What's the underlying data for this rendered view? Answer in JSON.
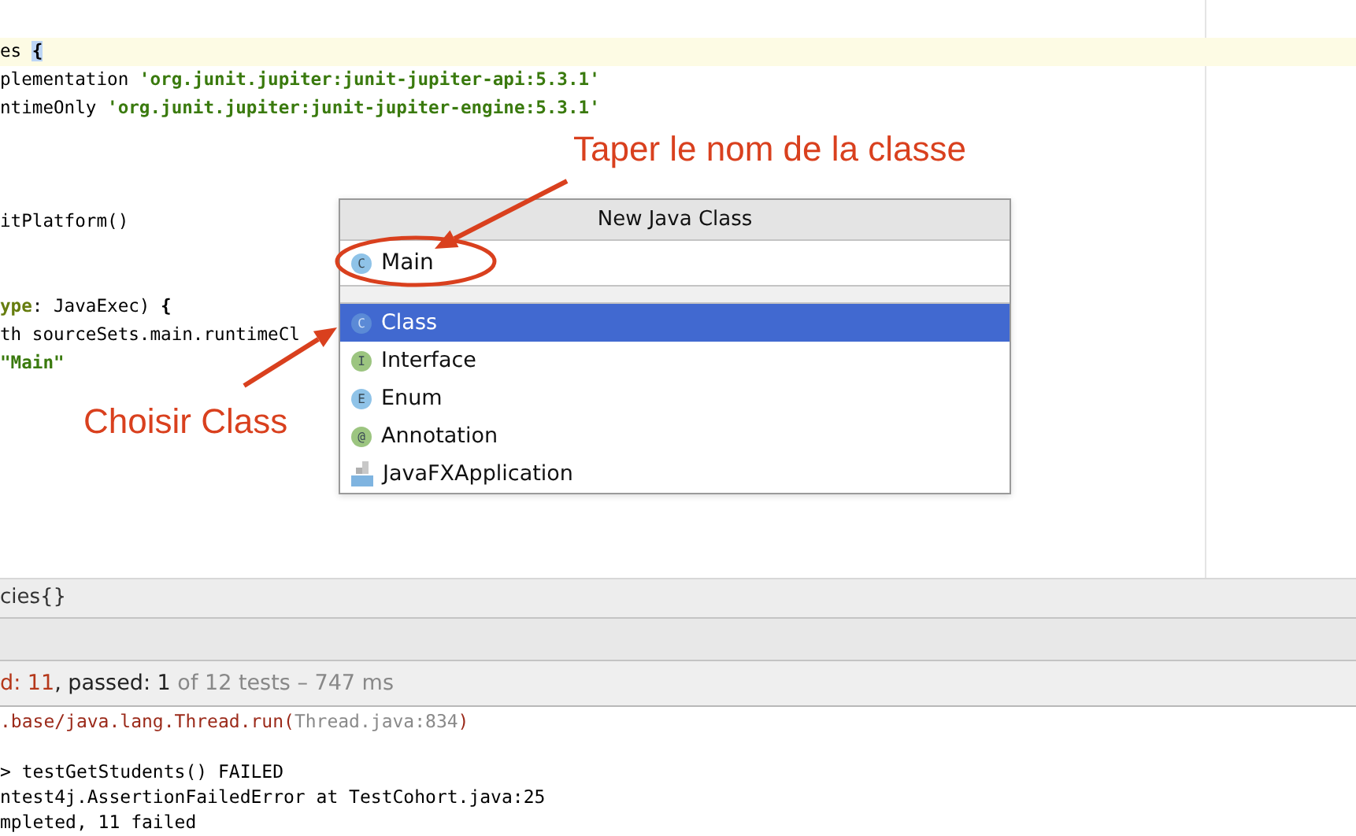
{
  "editor": {
    "lines": [
      {
        "current": true,
        "segments": [
          {
            "kind": "plain",
            "text": "es "
          },
          {
            "kind": "brace",
            "text": "{"
          }
        ]
      },
      {
        "current": false,
        "segments": [
          {
            "kind": "plain",
            "text": "plementation "
          },
          {
            "kind": "string",
            "text": "'org.junit.jupiter:junit-jupiter-api:5.3.1'"
          }
        ]
      },
      {
        "current": false,
        "segments": [
          {
            "kind": "plain",
            "text": "ntimeOnly "
          },
          {
            "kind": "string",
            "text": "'org.junit.jupiter:junit-jupiter-engine:5.3.1'"
          }
        ]
      },
      {
        "current": false
      },
      {
        "current": false
      },
      {
        "current": false
      },
      {
        "current": false,
        "segments": [
          {
            "kind": "plain",
            "text": "itPlatform()"
          }
        ]
      },
      {
        "current": false
      },
      {
        "current": false
      },
      {
        "current": false,
        "segments": [
          {
            "kind": "named",
            "text": "ype"
          },
          {
            "kind": "plain",
            "text": ": JavaExec) "
          },
          {
            "kind": "bold",
            "text": "{"
          }
        ]
      },
      {
        "current": false,
        "segments": [
          {
            "kind": "plain",
            "text": "th sourceSets.main.runtimeCl"
          }
        ]
      },
      {
        "current": false,
        "segments": [
          {
            "kind": "string",
            "text": "\"Main\""
          }
        ]
      }
    ]
  },
  "popup": {
    "title": "New Java Class",
    "name_field": {
      "badge": "C",
      "value": "Main"
    },
    "items": [
      {
        "kind": "class",
        "badge": "C",
        "label": "Class",
        "selected": true
      },
      {
        "kind": "interface",
        "badge": "I",
        "label": "Interface",
        "selected": false
      },
      {
        "kind": "enum",
        "badge": "E",
        "label": "Enum",
        "selected": false
      },
      {
        "kind": "annotation",
        "badge": "@",
        "label": "Annotation",
        "selected": false
      },
      {
        "kind": "javafx",
        "label": "JavaFXApplication",
        "selected": false
      }
    ]
  },
  "annotations": [
    {
      "kind": "top",
      "text": "Taper le nom de la classe"
    },
    {
      "kind": "left",
      "text": "Choisir Class"
    }
  ],
  "breadcrumb": "cies{}",
  "test_status": [
    {
      "kind": "failed",
      "text": "d: 11"
    },
    {
      "kind": "passed",
      "text": ", passed: 1"
    },
    {
      "kind": "meta",
      "text": " of 12 tests – 747 ms"
    }
  ],
  "console": [
    {
      "segments": [
        {
          "kind": "error",
          "text": ".base/java.lang.Thread.run("
        },
        {
          "kind": "link",
          "text": "Thread.java:834"
        },
        {
          "kind": "error",
          "text": ")"
        }
      ]
    },
    {
      "gap_before": true,
      "segments": [
        {
          "kind": "plain",
          "text": "> testGetStudents() FAILED"
        }
      ]
    },
    {
      "segments": [
        {
          "kind": "plain",
          "text": "ntest4j.AssertionFailedError at TestCohort.java:25"
        }
      ]
    },
    {
      "segments": [
        {
          "kind": "plain",
          "text": "mpleted, 11 failed"
        }
      ]
    }
  ]
}
